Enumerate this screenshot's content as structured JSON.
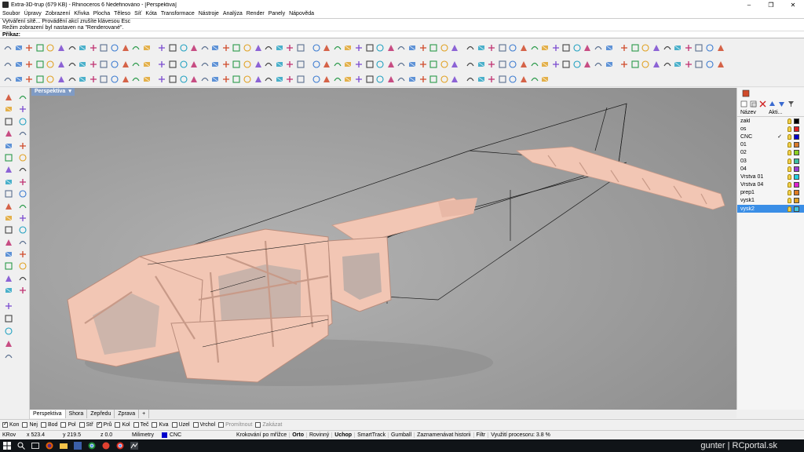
{
  "window": {
    "title": "Extra-3D-trup (679 KB) - Rhinoceros 6 Nedefinováno - [Perspektiva]",
    "minimize": "–",
    "maximize": "❐",
    "close": "✕"
  },
  "menu": [
    "Soubor",
    "Úpravy",
    "Zobrazení",
    "Křivka",
    "Plocha",
    "Těleso",
    "Síť",
    "Kóta",
    "Transformace",
    "Nástroje",
    "Analýza",
    "Render",
    "Panely",
    "Nápověda"
  ],
  "command": {
    "history_1": "Vytváření sítě... Provádění akcí zrušíte klávesou Esc",
    "history_2": "Režim zobrazení byl nastaven na \"Renderované\".",
    "prompt_label": "Příkaz:",
    "input_value": ""
  },
  "viewport": {
    "active_name": "Perspektiva",
    "dropdown_glyph": "▾",
    "background_color": "#a0a0a0",
    "wood_color": "#f2c6b4"
  },
  "view_tabs": [
    "Perspektiva",
    "Shora",
    "Zepředu",
    "Zprava"
  ],
  "add_tab": "+",
  "layers_panel": {
    "columns": {
      "name": "Název",
      "active": "Akti..."
    },
    "layers": [
      {
        "name": "zakl",
        "current": "",
        "color": "#000000"
      },
      {
        "name": "os",
        "current": "",
        "color": "#e02020"
      },
      {
        "name": "CNC",
        "current": "✓",
        "color": "#0000cc"
      },
      {
        "name": "01",
        "current": "",
        "color": "#d97a2a"
      },
      {
        "name": "02",
        "current": "",
        "color": "#8bd020"
      },
      {
        "name": "03",
        "current": "",
        "color": "#3cc0a0"
      },
      {
        "name": "04",
        "current": "",
        "color": "#9b3bd6"
      },
      {
        "name": "Vrstva 01",
        "current": "",
        "color": "#20d0e0"
      },
      {
        "name": "Vrstva 04",
        "current": "",
        "color": "#e020d0"
      },
      {
        "name": "prep1",
        "current": "",
        "color": "#e07a20"
      },
      {
        "name": "vysk1",
        "current": "",
        "color": "#e0a020"
      },
      {
        "name": "vysk2",
        "current": "",
        "color": "#40c8e0"
      }
    ],
    "selected_layer": "vysk2"
  },
  "osnaps": [
    {
      "label": "Kon",
      "checked": true,
      "disabled": false
    },
    {
      "label": "Nej",
      "checked": false,
      "disabled": false
    },
    {
      "label": "Bod",
      "checked": false,
      "disabled": false
    },
    {
      "label": "Pol",
      "checked": false,
      "disabled": false
    },
    {
      "label": "Stř",
      "checked": false,
      "disabled": false
    },
    {
      "label": "Prů",
      "checked": true,
      "disabled": false
    },
    {
      "label": "Kol",
      "checked": false,
      "disabled": false
    },
    {
      "label": "Teč",
      "checked": false,
      "disabled": false
    },
    {
      "label": "Kva",
      "checked": false,
      "disabled": false
    },
    {
      "label": "Uzel",
      "checked": false,
      "disabled": false
    },
    {
      "label": "Vrchol",
      "checked": false,
      "disabled": false
    },
    {
      "label": "Promítnout",
      "checked": false,
      "disabled": true
    },
    {
      "label": "Zakázat",
      "checked": false,
      "disabled": true
    }
  ],
  "status": {
    "plane": "KRov",
    "x": "x 523.4",
    "y": "y 219.5",
    "z": "z 0.0",
    "units": "Milimetry",
    "layer": "CNC",
    "layer_color": "#0000cc",
    "buttons": [
      {
        "label": "Krokování po mřížce",
        "bold": false
      },
      {
        "label": "Orto",
        "bold": true
      },
      {
        "label": "Rovinný",
        "bold": false
      },
      {
        "label": "Uchop",
        "bold": true
      },
      {
        "label": "SmartTrack",
        "bold": false
      },
      {
        "label": "Gumball",
        "bold": false
      },
      {
        "label": "Zaznamenávat historii",
        "bold": false
      },
      {
        "label": "Filtr",
        "bold": false
      }
    ],
    "cpu": "Využití procesoru: 3.8 %"
  },
  "watermark": "gunter | RCportal.sk",
  "icons": {
    "toolbar_row1": [
      "new-file-icon",
      "open-icon",
      "save-icon",
      "print-icon",
      "import-icon",
      "cut-icon",
      "copy-icon",
      "paste-icon",
      "undo-icon",
      "pan-icon",
      "rotate-view-icon",
      "zoom-icon",
      "zoom-window-icon",
      "zoom-extents-icon",
      "zoom-selected-icon",
      "set-view-icon",
      "four-views-icon",
      "cplane-icon",
      "select-icon",
      "lasso-icon",
      "layer-icon",
      "properties-icon",
      "light-icon",
      "point-icon",
      "color-icon",
      "material-icon",
      "render-icon",
      "render-preview-icon",
      "sun-icon",
      "environment-icon",
      "options-icon",
      "help-icon",
      "transform-icon",
      "move-icon",
      "copy-object-icon",
      "rotate-icon",
      "scale-icon",
      "mirror-icon",
      "array-icon",
      "align-icon",
      "orient-icon",
      "flow-icon",
      "twist-icon",
      "bend-icon",
      "taper-icon",
      "flag-icon",
      "lock-icon",
      "hide-icon",
      "show-icon",
      "group-icon",
      "ungroup-icon",
      "block-icon",
      "explode-icon",
      "join-icon",
      "trim-icon",
      "split-icon",
      "extend-icon",
      "offset-icon",
      "fillet-icon",
      "chamfer-icon",
      "blend-icon",
      "analyze-icon",
      "measure-icon",
      "dimension-icon",
      "text-icon",
      "hatch-icon"
    ],
    "left_tools": [
      "select-points-icon",
      "point-icon",
      "polyline-icon",
      "curve-icon",
      "circle-icon",
      "arc-icon",
      "ellipse-icon",
      "rectangle-icon",
      "polygon-icon",
      "freeform-icon",
      "surface-icon",
      "extrude-icon",
      "box-icon",
      "sphere-icon",
      "mesh-icon",
      "boolean-icon",
      "fillet-edge-icon",
      "move-icon",
      "rotate-icon",
      "scale-icon",
      "mirror-icon",
      "array-icon",
      "text-icon",
      "dimension-icon",
      "analyze-icon",
      "render-icon"
    ]
  }
}
